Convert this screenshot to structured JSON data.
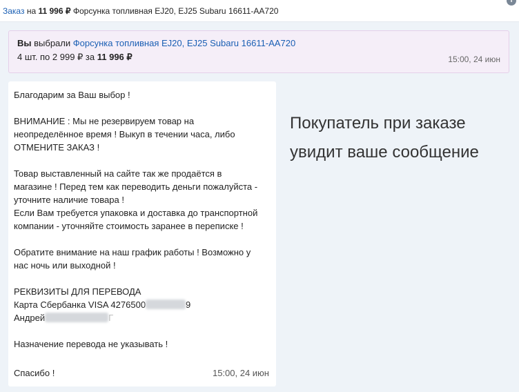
{
  "topbar": {
    "link": "Заказ",
    "on": "на",
    "amount": "11 996 ₽",
    "product": "Форсунка топливная EJ20, EJ25 Subaru 16611-AA720",
    "info_icon": "info-icon"
  },
  "order": {
    "you": "Вы",
    "chose": "выбрали",
    "product_link": "Форсунка топливная EJ20, EJ25 Subaru 16611-AA720",
    "qty_text": "4 шт. по 2 999 ₽ за",
    "total": "11 996 ₽",
    "time": "15:00, 24 июн"
  },
  "message": {
    "p1": "Благодарим за Ваш выбор !",
    "p2_l1": "ВНИМАНИЕ : Мы не резервируем товар на",
    "p2_l2": "неопределённое время ! Выкуп в течении часа, либо",
    "p2_l3": "ОТМЕНИТЕ ЗАКАЗ !",
    "p3_l1": "Товар выставленный на сайте так же продаётся в",
    "p3_l2": "магазине ! Перед тем как переводить деньги пожалуйста -",
    "p3_l3": "уточните наличие товара !",
    "p3_l4": "Если Вам требуется упаковка и доставка до транспортной",
    "p3_l5": "компании - уточняйте стоимость заранее в переписке !",
    "p4_l1": "Обратите внимание на наш график работы ! Возможно у",
    "p4_l2": "нас ночь или выходной !",
    "req_title": "РЕКВИЗИТЫ ДЛЯ ПЕРЕВОДА",
    "card_prefix": "Карта Сбербанка VISA 4276500",
    "card_suffix": "9",
    "name_prefix": "Андрей",
    "name_suffix": "Г",
    "p6": "Назначение перевода не указывать !",
    "thanks": "Спасибо !",
    "time": "15:00, 24 июн"
  },
  "side_caption": {
    "line1": "Покупатель при заказе",
    "line2": "увидит ваше сообщение"
  }
}
